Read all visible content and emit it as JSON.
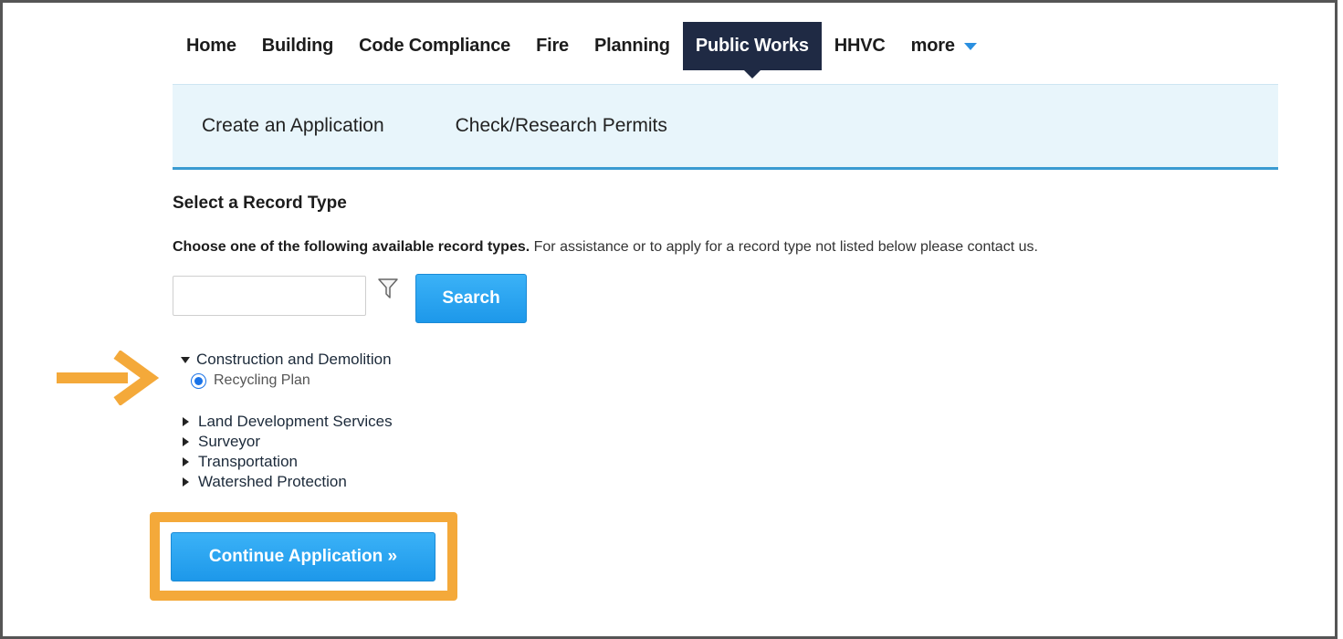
{
  "nav": {
    "items": [
      {
        "label": "Home",
        "active": false
      },
      {
        "label": "Building",
        "active": false
      },
      {
        "label": "Code Compliance",
        "active": false
      },
      {
        "label": "Fire",
        "active": false
      },
      {
        "label": "Planning",
        "active": false
      },
      {
        "label": "Public Works",
        "active": true
      },
      {
        "label": "HHVC",
        "active": false
      },
      {
        "label": "more",
        "active": false
      }
    ]
  },
  "subnav": {
    "items": [
      {
        "label": "Create an Application"
      },
      {
        "label": "Check/Research Permits"
      }
    ]
  },
  "content": {
    "title": "Select a Record Type",
    "instructions_bold": "Choose one of the following available record types.",
    "instructions_rest": " For assistance or to apply for a record type not listed below please contact us.",
    "search": {
      "placeholder": "",
      "value": "",
      "button_label": "Search"
    }
  },
  "tree": {
    "expanded": {
      "label": "Construction and Demolition",
      "child": "Recycling Plan",
      "child_selected": true
    },
    "collapsed": [
      {
        "label": "Land Development Services"
      },
      {
        "label": "Surveyor"
      },
      {
        "label": "Transportation"
      },
      {
        "label": "Watershed Protection"
      }
    ]
  },
  "actions": {
    "continue_label": "Continue Application »"
  },
  "colors": {
    "active_nav_bg": "#1f2a44",
    "subnav_bg": "#e8f5fb",
    "button_blue": "#1d98ea",
    "highlight_orange": "#f4a93a"
  }
}
